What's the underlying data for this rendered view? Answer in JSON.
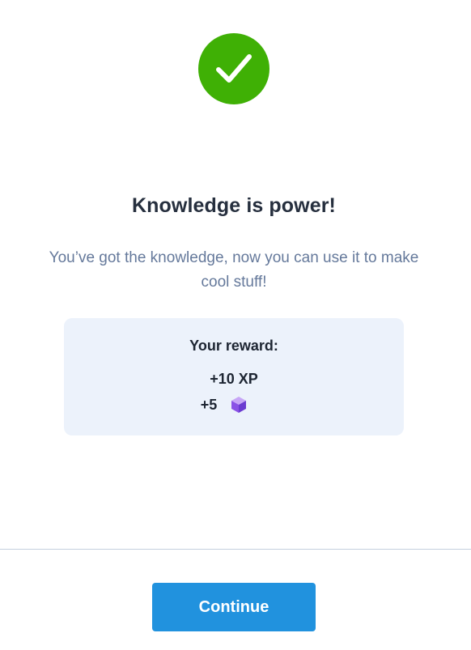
{
  "success": {
    "icon": "checkmark-icon",
    "color": "#3fb005"
  },
  "headline": "Knowledge is power!",
  "subtitle": "You’ve got the knowledge, now you can use it to make cool stuff!",
  "reward": {
    "title": "Your reward:",
    "xp": "+10 XP",
    "gems": "+5",
    "gem_icon": "purple-gem-cube-icon",
    "card_color": "#ecf2fb"
  },
  "actions": {
    "continue_label": "Continue",
    "continue_color": "#2192de"
  }
}
